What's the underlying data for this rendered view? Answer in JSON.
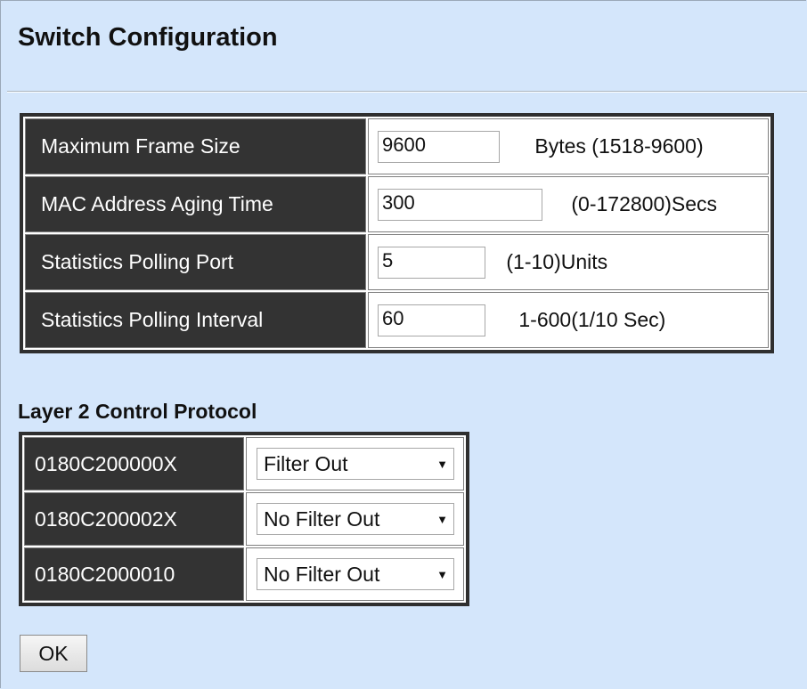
{
  "page": {
    "title": "Switch Configuration"
  },
  "config": {
    "rows": [
      {
        "label": "Maximum Frame Size",
        "value": "9600",
        "unit": "Bytes (1518-9600)"
      },
      {
        "label": "MAC Address Aging Time",
        "value": "300",
        "unit": "(0-172800)Secs"
      },
      {
        "label": "Statistics Polling Port",
        "value": "5",
        "unit": "(1-10)Units"
      },
      {
        "label": "Statistics Polling Interval",
        "value": "60",
        "unit": "1-600(1/10 Sec)"
      }
    ]
  },
  "l2cp": {
    "heading": "Layer 2 Control Protocol",
    "rows": [
      {
        "label": "0180C200000X",
        "selected": "Filter Out"
      },
      {
        "label": "0180C200002X",
        "selected": "No Filter Out"
      },
      {
        "label": "0180C2000010",
        "selected": "No Filter Out"
      }
    ],
    "dropdown_arrow": "▼"
  },
  "actions": {
    "ok_label": "OK"
  }
}
